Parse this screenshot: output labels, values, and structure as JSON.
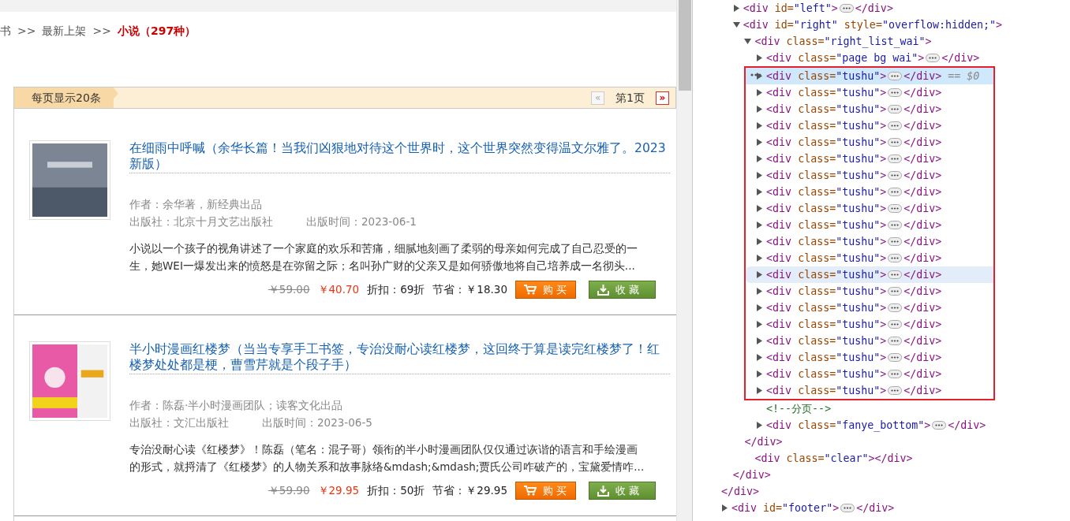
{
  "breadcrumb": [
    {
      "kind": "link",
      "text": "书",
      "current": false
    },
    {
      "text": ">>",
      "kind": "sep"
    },
    {
      "kind": "link",
      "text": "最新上架",
      "current": false
    },
    {
      "text": ">>",
      "kind": "sep"
    },
    {
      "kind": "link",
      "text": "小说（297种）",
      "current": true
    }
  ],
  "toolbar": {
    "per_page": "每页显示20条",
    "prev": {
      "label": "«",
      "disabled": true
    },
    "page": "第1页",
    "next": {
      "label": "»",
      "disabled": false
    }
  },
  "books": [
    {
      "title": "在细雨中呼喊（余华长篇！当我们凶狠地对待这个世界时，这个世界突然变得温文尔雅了。2023新版）",
      "author": "作者：余华著，新经典出品",
      "publisher": "出版社：北京十月文艺出版社",
      "date": "出版时间：2023-06-1",
      "description": "小说以一个孩子的视角讲述了一个家庭的欢乐和苦痛，细腻地刻画了柔弱的母亲如何完成了自己忍受的一生，她WEI一爆发出来的愤怒是在弥留之际；名叫孙广财的父亲又是如何骄傲地将自己培养成一名彻头...",
      "list_price": "￥59.00",
      "price": "￥40.70",
      "discount": "折扣：69折",
      "saving": "节省：￥18.30",
      "buy": "购 买",
      "favorite": "收 藏"
    },
    {
      "title": "半小时漫画红楼梦（当当专享手工书签，专治没耐心读红楼梦，这回终于算是读完红楼梦了！红楼梦处处都是梗，曹雪芹就是个段子手）",
      "author": "作者：陈磊·半小时漫画团队；读客文化出品",
      "publisher": "出版社：文汇出版社",
      "date": "出版时间：2023-06-5",
      "description": "专治没耐心读《红楼梦》！陈磊（笔名：混子哥）领衔的半小时漫画团队仅仅通过诙谐的语言和手绘漫画的形式，就捋清了《红楼梦》的人物关系和故事脉络&mdash;&mdash;贾氏公司咋破产的，宝黛爱情咋...",
      "list_price": "￥59.90",
      "price": "￥29.95",
      "discount": "折扣：50折",
      "saving": "节省：￥29.95",
      "buy": "购 买",
      "favorite": "收 藏"
    }
  ],
  "devtools": {
    "nodes": [
      {
        "kind": "element",
        "expanded": true,
        "selected": false,
        "hovered": false,
        "boxed": false,
        "close": "</div>",
        "children": [
          {
            "kind": "element",
            "open": "<div id=\"left\">",
            "close": "</div>",
            "expanded": false,
            "has_children": true,
            "selected": false,
            "hovered": false,
            "boxed": false
          },
          {
            "kind": "element",
            "open": "<div id=\"right\" style=\"overflow:hidden;\">",
            "close": "</div>",
            "expanded": true,
            "has_children": true,
            "selected": false,
            "hovered": false,
            "boxed": false,
            "children": [
              {
                "kind": "element",
                "open": "<div class=\"right_list_wai\">",
                "close": "</div>",
                "expanded": true,
                "has_children": true,
                "selected": false,
                "hovered": false,
                "boxed": false,
                "children": [
                  {
                    "kind": "element",
                    "open": "<div class=\"page bg wai\">",
                    "close": "</div>",
                    "expanded": false,
                    "has_children": true,
                    "selected": false,
                    "hovered": false,
                    "boxed": false
                  },
                  {
                    "kind": "element",
                    "open": "<div class=\"tushu\">",
                    "close": "</div>",
                    "expanded": false,
                    "has_children": true,
                    "selected": true,
                    "hovered": false,
                    "boxed": true,
                    "note": "== $0"
                  },
                  {
                    "kind": "element",
                    "open": "<div class=\"tushu\">",
                    "close": "</div>",
                    "expanded": false,
                    "has_children": true,
                    "selected": false,
                    "hovered": false,
                    "boxed": true
                  },
                  {
                    "kind": "element",
                    "open": "<div class=\"tushu\">",
                    "close": "</div>",
                    "expanded": false,
                    "has_children": true,
                    "selected": false,
                    "hovered": false,
                    "boxed": true
                  },
                  {
                    "kind": "element",
                    "open": "<div class=\"tushu\">",
                    "close": "</div>",
                    "expanded": false,
                    "has_children": true,
                    "selected": false,
                    "hovered": false,
                    "boxed": true
                  },
                  {
                    "kind": "element",
                    "open": "<div class=\"tushu\">",
                    "close": "</div>",
                    "expanded": false,
                    "has_children": true,
                    "selected": false,
                    "hovered": false,
                    "boxed": true
                  },
                  {
                    "kind": "element",
                    "open": "<div class=\"tushu\">",
                    "close": "</div>",
                    "expanded": false,
                    "has_children": true,
                    "selected": false,
                    "hovered": false,
                    "boxed": true
                  },
                  {
                    "kind": "element",
                    "open": "<div class=\"tushu\">",
                    "close": "</div>",
                    "expanded": false,
                    "has_children": true,
                    "selected": false,
                    "hovered": false,
                    "boxed": true
                  },
                  {
                    "kind": "element",
                    "open": "<div class=\"tushu\">",
                    "close": "</div>",
                    "expanded": false,
                    "has_children": true,
                    "selected": false,
                    "hovered": false,
                    "boxed": true
                  },
                  {
                    "kind": "element",
                    "open": "<div class=\"tushu\">",
                    "close": "</div>",
                    "expanded": false,
                    "has_children": true,
                    "selected": false,
                    "hovered": false,
                    "boxed": true
                  },
                  {
                    "kind": "element",
                    "open": "<div class=\"tushu\">",
                    "close": "</div>",
                    "expanded": false,
                    "has_children": true,
                    "selected": false,
                    "hovered": false,
                    "boxed": true
                  },
                  {
                    "kind": "element",
                    "open": "<div class=\"tushu\">",
                    "close": "</div>",
                    "expanded": false,
                    "has_children": true,
                    "selected": false,
                    "hovered": false,
                    "boxed": true
                  },
                  {
                    "kind": "element",
                    "open": "<div class=\"tushu\">",
                    "close": "</div>",
                    "expanded": false,
                    "has_children": true,
                    "selected": false,
                    "hovered": false,
                    "boxed": true
                  },
                  {
                    "kind": "element",
                    "open": "<div class=\"tushu\">",
                    "close": "</div>",
                    "expanded": false,
                    "has_children": true,
                    "selected": false,
                    "hovered": true,
                    "boxed": true
                  },
                  {
                    "kind": "element",
                    "open": "<div class=\"tushu\">",
                    "close": "</div>",
                    "expanded": false,
                    "has_children": true,
                    "selected": false,
                    "hovered": false,
                    "boxed": true
                  },
                  {
                    "kind": "element",
                    "open": "<div class=\"tushu\">",
                    "close": "</div>",
                    "expanded": false,
                    "has_children": true,
                    "selected": false,
                    "hovered": false,
                    "boxed": true
                  },
                  {
                    "kind": "element",
                    "open": "<div class=\"tushu\">",
                    "close": "</div>",
                    "expanded": false,
                    "has_children": true,
                    "selected": false,
                    "hovered": false,
                    "boxed": true
                  },
                  {
                    "kind": "element",
                    "open": "<div class=\"tushu\">",
                    "close": "</div>",
                    "expanded": false,
                    "has_children": true,
                    "selected": false,
                    "hovered": false,
                    "boxed": true
                  },
                  {
                    "kind": "element",
                    "open": "<div class=\"tushu\">",
                    "close": "</div>",
                    "expanded": false,
                    "has_children": true,
                    "selected": false,
                    "hovered": false,
                    "boxed": true
                  },
                  {
                    "kind": "element",
                    "open": "<div class=\"tushu\">",
                    "close": "</div>",
                    "expanded": false,
                    "has_children": true,
                    "selected": false,
                    "hovered": false,
                    "boxed": true
                  },
                  {
                    "kind": "element",
                    "open": "<div class=\"tushu\">",
                    "close": "</div>",
                    "expanded": false,
                    "has_children": true,
                    "selected": false,
                    "hovered": false,
                    "boxed": true
                  },
                  {
                    "kind": "comment",
                    "text": "<!--分页-->"
                  },
                  {
                    "kind": "element",
                    "open": "<div class=\"fanye_bottom\">",
                    "close": "</div>",
                    "expanded": false,
                    "has_children": true,
                    "selected": false,
                    "hovered": false,
                    "boxed": false
                  }
                ]
              },
              {
                "kind": "element",
                "open": "<div class=\"clear\">",
                "close": "</div>",
                "expanded": false,
                "has_children": false,
                "selected": false,
                "hovered": false,
                "boxed": false
              }
            ]
          }
        ]
      },
      {
        "kind": "element",
        "open": "<div id=\"footer\">",
        "close": "</div>",
        "expanded": false,
        "has_children": true,
        "selected": false,
        "hovered": false,
        "boxed": false
      }
    ]
  }
}
